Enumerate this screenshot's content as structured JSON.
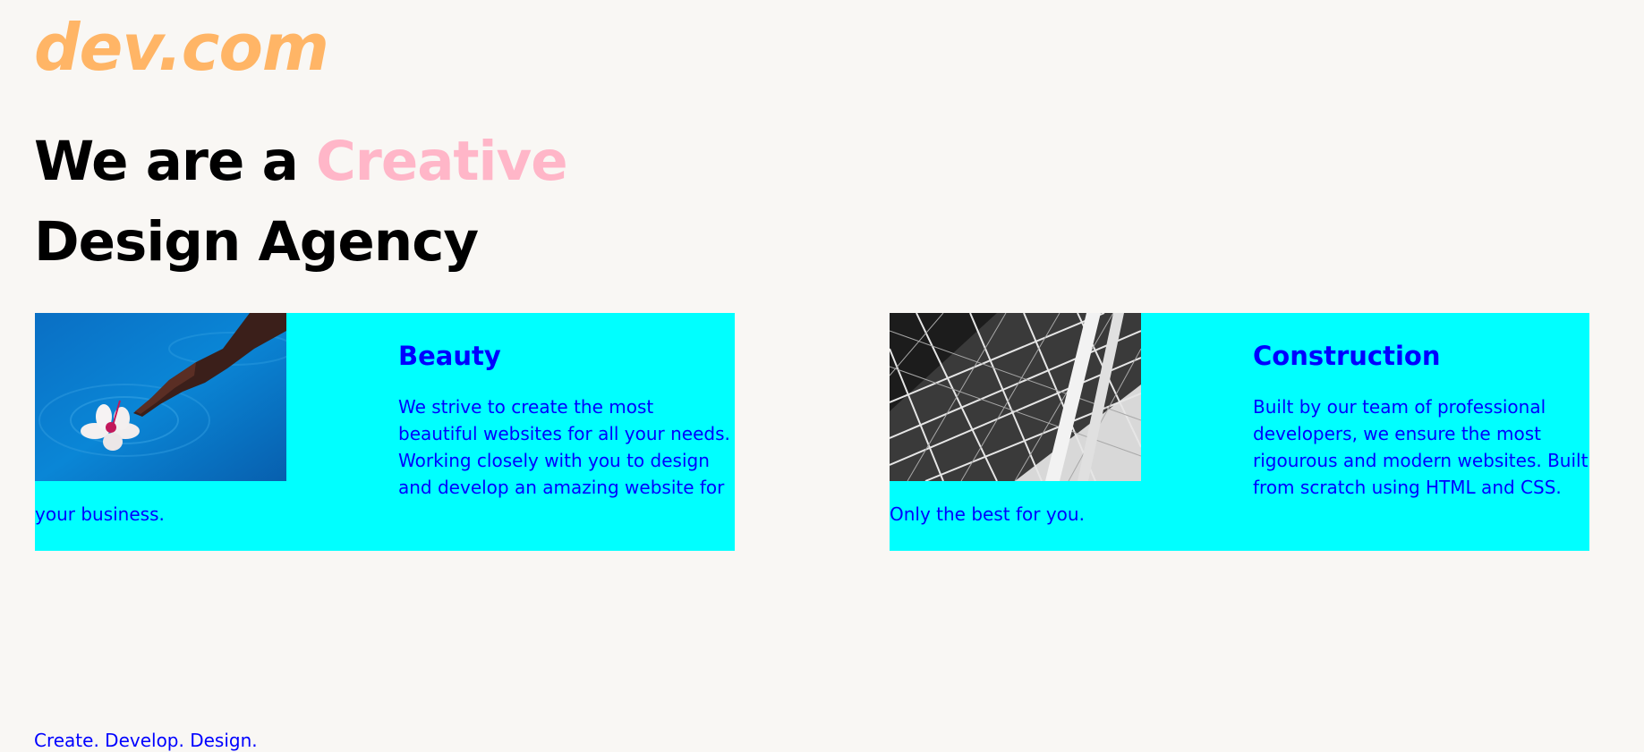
{
  "brand": {
    "logo_text": "dev.com",
    "logo_color": "#ffb566"
  },
  "hero": {
    "line1_prefix": "We are a",
    "line1_accent": "Creative",
    "line2": "Design Agency",
    "accent_color": "#ffb6c8"
  },
  "cards": [
    {
      "image": "flower-on-water-photo",
      "title": "Beauty",
      "text": "We strive to create the most beautiful websites for all your needs. Working closely with you to design and develop an amazing website for your business."
    },
    {
      "image": "steel-structure-photo",
      "title": "Construction",
      "text": "Built by our team of professional developers, we ensure the most rigourous and modern websites. Built from scratch using HTML and CSS. Only the best for you."
    }
  ],
  "colors": {
    "background": "#f9f7f4",
    "card_background": "#00ffff",
    "card_text": "#0000ff",
    "heading": "#000000"
  },
  "footer": {
    "tagline": "Create. Develop. Design."
  }
}
